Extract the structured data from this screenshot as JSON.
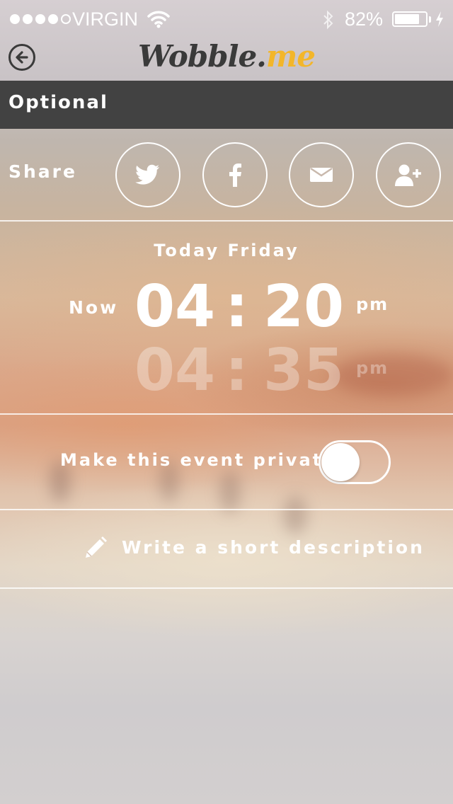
{
  "status_bar": {
    "signal_bars_filled": 4,
    "signal_bars_total": 5,
    "carrier": "VIRGIN",
    "battery_percent": "82%",
    "battery_level": 0.82
  },
  "nav": {
    "logo_main": "Wobble.",
    "logo_accent": "me",
    "back_icon": "back-arrow-circle-icon"
  },
  "section": {
    "title": "Optional"
  },
  "share": {
    "label": "Share",
    "buttons": [
      {
        "icon": "twitter-icon"
      },
      {
        "icon": "facebook-icon"
      },
      {
        "icon": "email-icon"
      },
      {
        "icon": "add-contact-icon"
      }
    ]
  },
  "time": {
    "day": "Today Friday",
    "now_label": "Now",
    "current": {
      "hour": "04",
      "separator": ":",
      "minute": "20",
      "ampm": "pm"
    },
    "next": {
      "hour": "04",
      "separator": ":",
      "minute": "35",
      "ampm": "pm"
    }
  },
  "private": {
    "label": "Make this event private",
    "enabled": false
  },
  "description": {
    "label": "Write a short description",
    "icon": "pencil-icon"
  },
  "colors": {
    "header_bg": "#424242",
    "logo_dark": "#3a3a3a",
    "logo_accent": "#f3b62a"
  }
}
